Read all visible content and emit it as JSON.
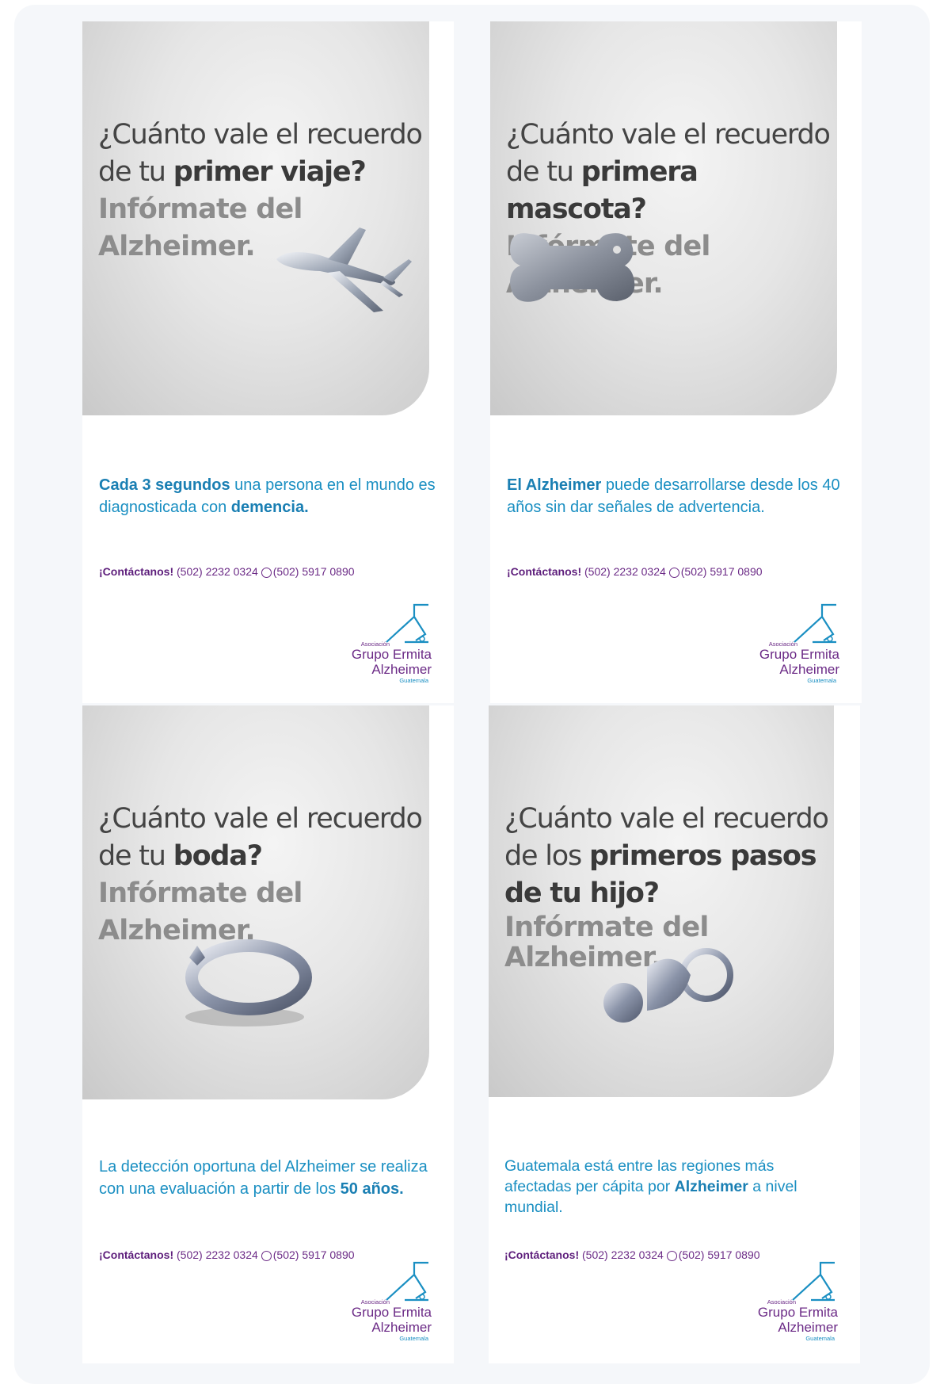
{
  "cards": [
    {
      "headline_prefix": "¿Cuánto vale el recuerdo",
      "headline_mid": "de tu ",
      "headline_bold": "primer viaje?",
      "headline_cta": "Infórmate del Alzheimer.",
      "fact_bold1": "Cada 3 segundos",
      "fact_text1": " una persona en el mundo es diagnosticada con ",
      "fact_bold2": "demencia.",
      "object_icon": "airplane-icon"
    },
    {
      "headline_prefix": "¿Cuánto vale el recuerdo",
      "headline_mid": "de tu ",
      "headline_bold": "primera mascota?",
      "headline_cta": "Infórmate del Alzheimer.",
      "fact_bold1": "El Alzheimer",
      "fact_text1": " puede desarrollarse desde los 40 años sin dar señales de advertencia.",
      "fact_bold2": "",
      "object_icon": "bone-tag-icon"
    },
    {
      "headline_prefix": "¿Cuánto vale el recuerdo",
      "headline_mid": "de tu ",
      "headline_bold": "boda?",
      "headline_cta": "Infórmate del Alzheimer.",
      "fact_bold1": "",
      "fact_text1": "La detección oportuna del Alzheimer se realiza con una evaluación a partir de los ",
      "fact_bold2": "50 años.",
      "object_icon": "ring-icon"
    },
    {
      "headline_prefix": "¿Cuánto vale el recuerdo",
      "headline_mid": "de los ",
      "headline_bold": "primeros pasos",
      "headline_bold_line2": "de tu hijo?",
      "headline_cta": "Infórmate del Alzheimer.",
      "fact_bold1": "",
      "fact_text1": "Guatemala está entre las regiones más afectadas per cápita por ",
      "fact_bold2": "Alzheimer",
      "fact_text2": " a nivel mundial.",
      "object_icon": "pacifier-icon"
    }
  ],
  "contact": {
    "label": "¡Contáctanos!",
    "phone": " (502) 2232 0324",
    "whatsapp": "(502) 5917 0890"
  },
  "logo": {
    "line1": "Asociación",
    "line2": "Grupo Ermita",
    "line3": "Alzheimer",
    "line4": "Guatemala"
  },
  "colors": {
    "accent_blue": "#1a8fc2",
    "brand_purple": "#6b2a86",
    "headline_gray": "#444444"
  }
}
